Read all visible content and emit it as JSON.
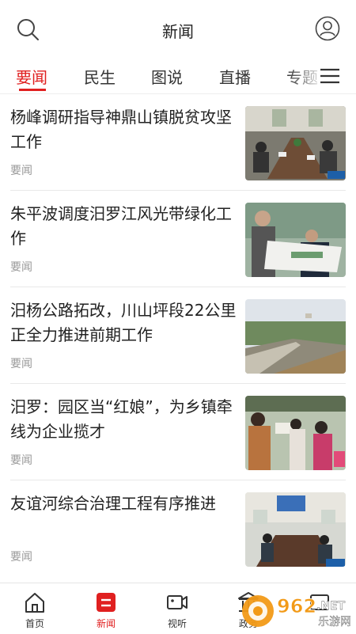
{
  "header": {
    "title": "新闻"
  },
  "tabs": [
    {
      "label": "要闻",
      "active": true
    },
    {
      "label": "民生"
    },
    {
      "label": "图说"
    },
    {
      "label": "直播"
    },
    {
      "label": "专题"
    }
  ],
  "news": [
    {
      "title": "杨峰调研指导神鼎山镇脱贫攻坚工作",
      "tag": "要闻"
    },
    {
      "title": "朱平波调度汨罗江风光带绿化工作",
      "tag": "要闻"
    },
    {
      "title": "汨杨公路拓改，川山坪段22公里正全力推进前期工作",
      "tag": "要闻"
    },
    {
      "title": "汨罗：园区当“红娘”，为乡镇牵线为企业揽才",
      "tag": "要闻"
    },
    {
      "title": "友谊河综合治理工程有序推进",
      "tag": "要闻"
    }
  ],
  "bottom_nav": [
    {
      "label": "首页",
      "icon": "home-icon"
    },
    {
      "label": "新闻",
      "icon": "news-icon",
      "active": true
    },
    {
      "label": "视听",
      "icon": "video-icon"
    },
    {
      "label": "政务",
      "icon": "government-icon"
    },
    {
      "label": "",
      "icon": "more-icon"
    }
  ],
  "watermark": {
    "brand": "962",
    "tld": ".NET",
    "sub": "乐游网"
  },
  "colors": {
    "accent": "#e02020",
    "text": "#222222",
    "muted": "#999999"
  }
}
